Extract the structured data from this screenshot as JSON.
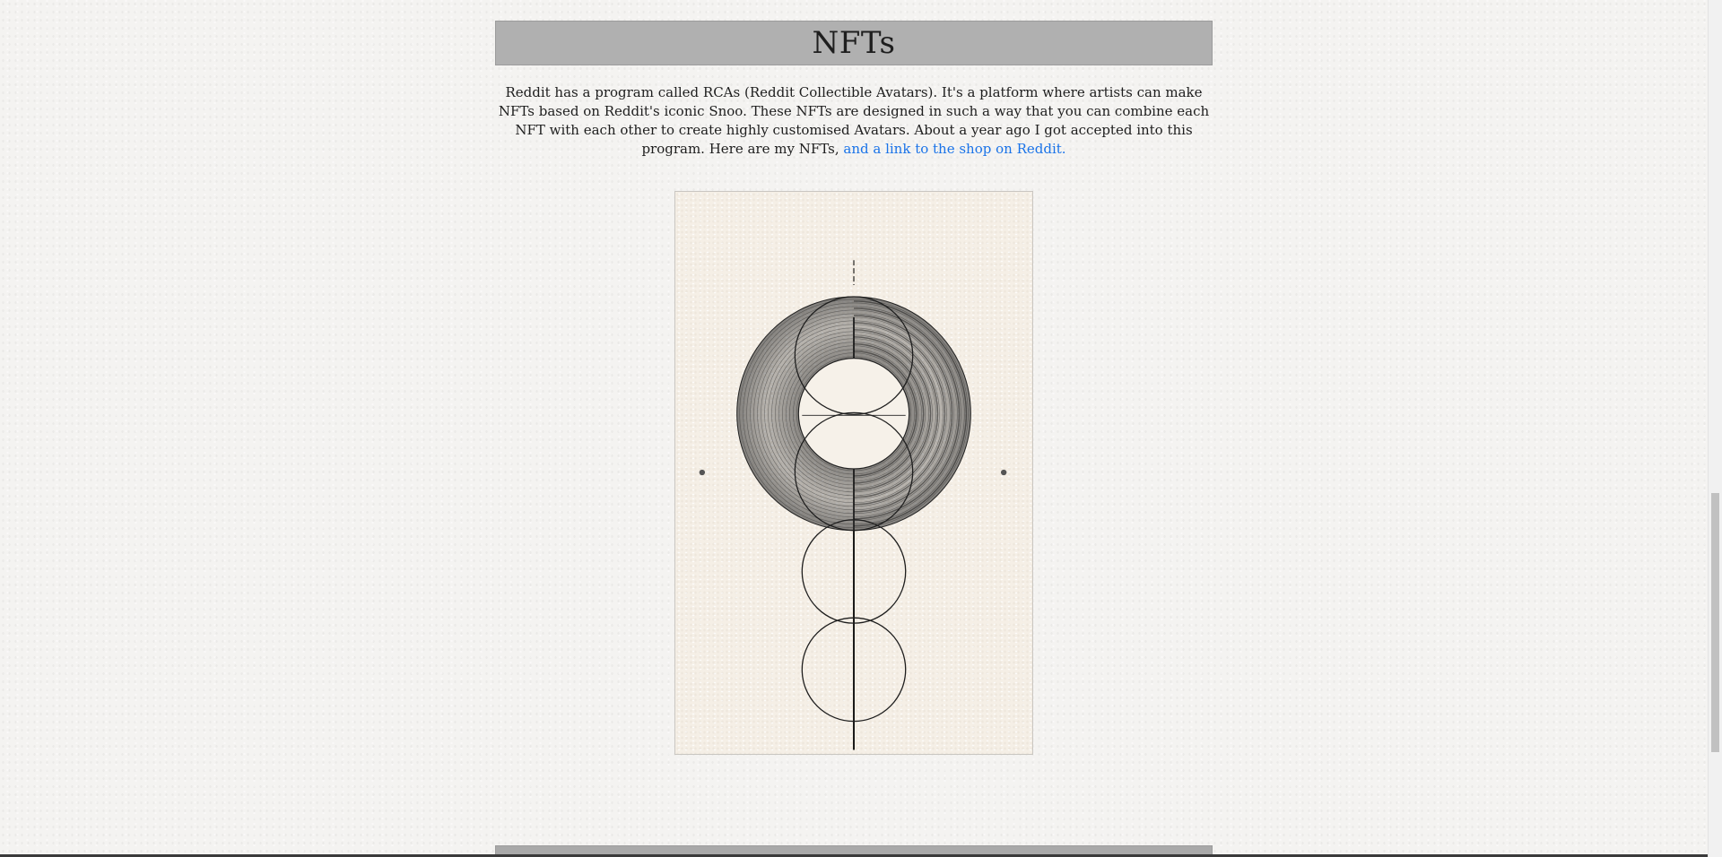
{
  "section": {
    "title": "NFTs",
    "intro_text": "Reddit has a program called RCAs (Reddit Collectible Avatars). It's a platform where artists can make NFTs based on Reddit's iconic Snoo. These NFTs are designed in such a way that you can combine each NFT with each other to create highly customised Avatars. About a year ago I got accepted into this program. Here are my NFTs, ",
    "shop_link_text": "and a link to the shop on Reddit."
  },
  "artwork": {
    "icon": "nft-artwork-image"
  },
  "colors": {
    "header_bg": "#b0b0b0",
    "link": "#1a73e8",
    "page_bg": "#f4f3f1"
  }
}
